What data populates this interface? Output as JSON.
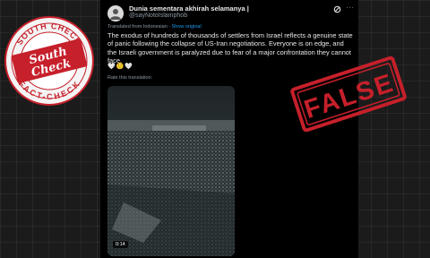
{
  "post": {
    "display_name": "Dunia sementara akhirah selamanya |",
    "handle": "@sayNotoIslamphob",
    "translated_prefix": "Translated from Indonesian ·",
    "show_original": "Show original",
    "text": "The exodus of hundreds of thousands of settlers from Israel reflects a genuine state of panic following the collapse of US-Iran negotiations. Everyone is on edge, and the Israeli government is paralyzed due to fear of a major confrontation they cannot face.",
    "emoji": "🤍🙂🤍",
    "rate_label": "Rate this translation:",
    "video_duration": "0:14"
  },
  "stamps": {
    "logo_top": "SOUTH CHECK",
    "logo_bottom": "FACT-CHECK",
    "logo_center_1": "South",
    "logo_center_2": "Check",
    "false_label": "FALSE"
  },
  "colors": {
    "stamp_red": "#c6202b",
    "link_blue": "#1d9bf0",
    "background": "#1b1b1b"
  }
}
